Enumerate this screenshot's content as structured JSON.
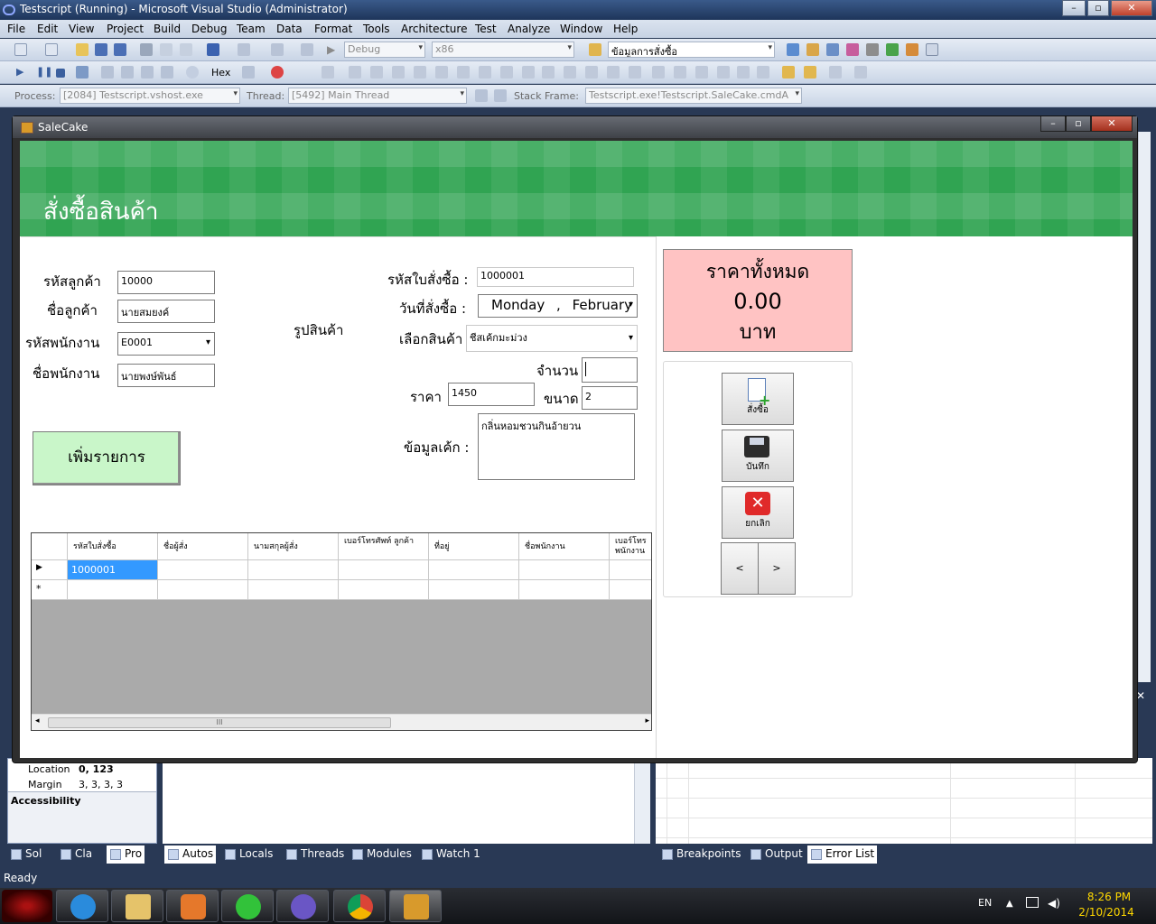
{
  "vs": {
    "title": "Testscript (Running) - Microsoft Visual Studio (Administrator)",
    "menu": [
      "File",
      "Edit",
      "View",
      "Project",
      "Build",
      "Debug",
      "Team",
      "Data",
      "Format",
      "Tools",
      "Architecture",
      "Test",
      "Analyze",
      "Window",
      "Help"
    ],
    "config": "Debug",
    "platform": "x86",
    "find_combo": "ข้อมูลการสั่งซื้อ",
    "hex_label": "Hex",
    "process_label": "Process:",
    "process_value": "[2084] Testscript.vshost.exe",
    "thread_label": "Thread:",
    "thread_value": "[5492] Main Thread",
    "stack_label": "Stack Frame:",
    "stack_value": "Testscript.exe!Testscript.SaleCake.cmdA",
    "props": {
      "location_label": "Location",
      "location_value": "0, 123",
      "margin_label": "Margin",
      "margin_value": "3, 3, 3, 3",
      "category": "Accessibility"
    },
    "left_tabs": [
      "Sol",
      "Cla",
      "Pro"
    ],
    "debug_tabs": [
      "Autos",
      "Locals",
      "Threads",
      "Modules",
      "Watch 1"
    ],
    "right_tabs": [
      "Breakpoints",
      "Output",
      "Error List"
    ],
    "status": "Ready"
  },
  "taskbar": {
    "lang": "EN",
    "time": "8:26 PM",
    "date": "2/10/2014"
  },
  "salecake": {
    "title": "SaleCake",
    "banner_title": "สั่งซื้อสินค้า",
    "form": {
      "customer_id_label": "รหัสลูกค้า",
      "customer_id_value": "10000",
      "customer_name_label": "ชื่อลูกค้า",
      "customer_name_value": "นายสมยงค์",
      "employee_id_label": "รหัสพนักงาน",
      "employee_id_value": "E0001",
      "employee_name_label": "ชื่อพนักงาน",
      "employee_name_value": "นายพงษ์พันธ์",
      "product_image_label": "รูปสินค้า",
      "order_id_label": "รหัสใบสั่งซื้อ :",
      "order_id_value": "1000001",
      "order_date_label": "วันที่สั่งซื้อ :",
      "order_date_day": "Monday",
      "order_date_sep": ",",
      "order_date_month": "February",
      "product_label": "เลือกสินค้า",
      "product_value": "ชีสเค้กมะม่วง",
      "quantity_label": "จำนวน",
      "quantity_value": "",
      "price_label": "ราคา",
      "price_value": "1450",
      "size_label": "ขนาด",
      "size_value": "2",
      "cake_info_label": "ข้อมูลเค้ก :",
      "cake_info_value": "กลิ่นหอมชวนกินอ้ายวน",
      "add_item_button": "เพิ่มรายการ"
    },
    "total": {
      "label": "ราคาทั้งหมด",
      "value": "0.00",
      "unit": "บาท"
    },
    "actions": {
      "order": "สั่งซื้อ",
      "save": "บันทึก",
      "cancel": "ยกเลิก",
      "prev": "<",
      "next": ">"
    },
    "grid": {
      "columns": [
        "รหัสใบสั่งซื้อ",
        "ชื่อผู้สั่ง",
        "นามสกุลผู้สั่ง",
        "เบอร์โทรศัพท์ ลูกค้า",
        "ที่อยู่",
        "ชื่อพนักงาน",
        "เบอร์โทร พนักงาน"
      ],
      "rows": [
        [
          "1000001",
          "",
          "",
          "",
          "",
          "",
          ""
        ]
      ],
      "new_row_marker": "*",
      "current_row_marker": "▶",
      "scroll_grip": "III"
    }
  }
}
